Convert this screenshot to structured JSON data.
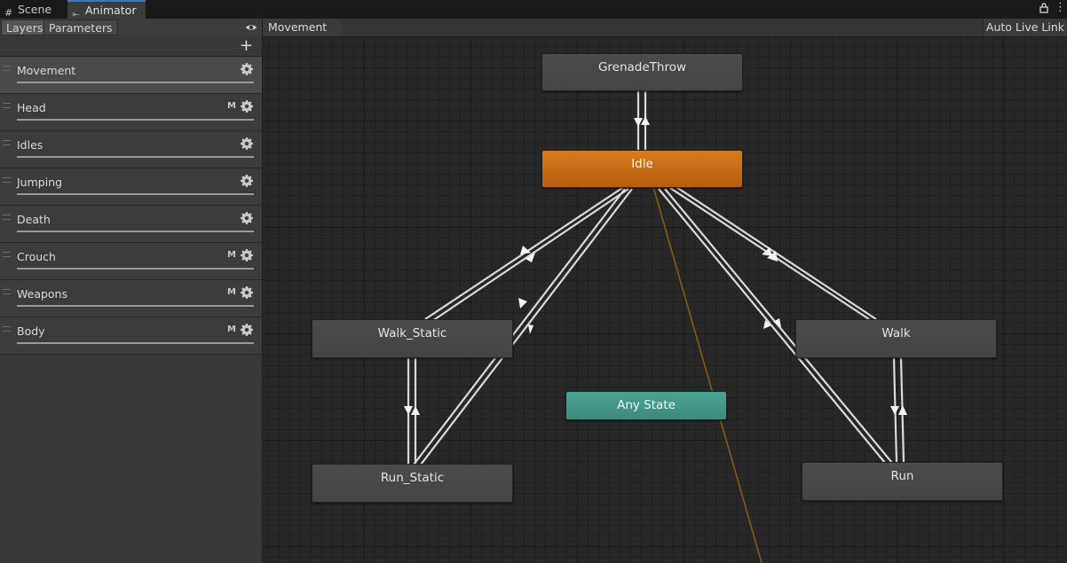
{
  "window_tabs": [
    {
      "label": "Scene",
      "icon": "grid-icon"
    },
    {
      "label": "Animator",
      "icon": "state-machine-icon",
      "active": true
    }
  ],
  "left_panel": {
    "tabs": [
      "Layers",
      "Parameters"
    ],
    "selected_tab": "Layers",
    "add_label": "+",
    "layers": [
      {
        "name": "Movement",
        "flag": "",
        "selected": true
      },
      {
        "name": "Head",
        "flag": "M"
      },
      {
        "name": "Idles",
        "flag": ""
      },
      {
        "name": "Jumping",
        "flag": ""
      },
      {
        "name": "Death",
        "flag": ""
      },
      {
        "name": "Crouch",
        "flag": "M"
      },
      {
        "name": "Weapons",
        "flag": "M"
      },
      {
        "name": "Body",
        "flag": "M"
      }
    ]
  },
  "graph": {
    "breadcrumb": "Movement",
    "auto_live_link": "Auto Live Link",
    "states": {
      "grenade": "GrenadeThrow",
      "idle": "Idle",
      "walk_static": "Walk_Static",
      "walk": "Walk",
      "any": "Any State",
      "run_static": "Run_Static",
      "run": "Run"
    }
  },
  "colors": {
    "default_state": "#c86a16",
    "any_state": "#45988a",
    "transition": "#d9d9d9",
    "any_line": "#8a5a14"
  }
}
